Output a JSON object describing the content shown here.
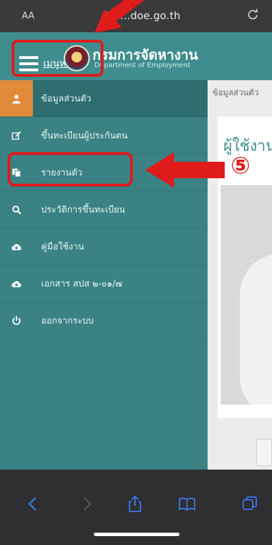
{
  "browser": {
    "text_size_label": "AA",
    "url": "e...doe.go.th"
  },
  "header": {
    "menu_label": "เมนูหลัก",
    "title": "กรมการจัดหางาน",
    "subtitle": "Department of Employment"
  },
  "sidebar": {
    "items": [
      {
        "label": "ข้อมูลส่วนตัว",
        "icon": "user-icon"
      },
      {
        "label": "ขึ้นทะเบียนผู้ประกันตน",
        "icon": "edit-icon"
      },
      {
        "label": "รายงานตัว",
        "icon": "copy-icon"
      },
      {
        "label": "ประวัติการขึ้นทะเบียน",
        "icon": "search-icon"
      },
      {
        "label": "คู่มือใช้งาน",
        "icon": "cloud-download-icon"
      },
      {
        "label": "เอกสาร สปส ๒-๐๑/๗",
        "icon": "cloud-download-icon"
      },
      {
        "label": "ออกจากระบบ",
        "icon": "power-icon"
      }
    ]
  },
  "content": {
    "breadcrumb": "ข้อมูลส่วนตัว",
    "card_title": "ผู้ใช้งาน"
  },
  "annotation": {
    "step": "⑤"
  },
  "colors": {
    "header": "#3f8d8f",
    "sidebar": "#3a8284",
    "active_accent": "#e08a3a",
    "annotation_red": "#e01b1b"
  }
}
